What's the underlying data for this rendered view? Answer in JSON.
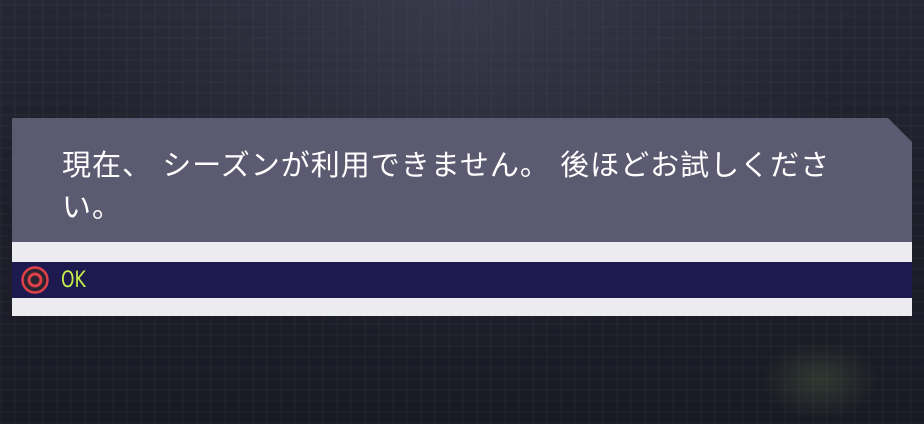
{
  "dialog": {
    "message": "現在、 シーズンが利用できません。 後ほどお試しください。",
    "options": [
      {
        "label": "OK",
        "button_icon": "circle-button-icon",
        "selected": true
      }
    ]
  },
  "colors": {
    "message_panel": "#5b5a70",
    "options_panel": "#ebebf0",
    "selected_option": "#1c1a4f",
    "option_text": "#c3ee4a",
    "button_icon": "#e0404a"
  }
}
